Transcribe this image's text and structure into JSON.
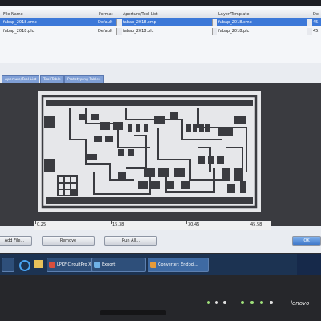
{
  "file_table": {
    "headers": [
      "File Name",
      "Format",
      "Aperture/Tool List",
      "Layer/Template",
      "De"
    ],
    "rows": [
      {
        "name": "fabap_2018.cmp",
        "format": "Default",
        "aperture": "fabap_2018.cmp",
        "layer": "fabap_2018.cmp",
        "extra": "45.",
        "selected": true
      },
      {
        "name": "fabap_2018.plc",
        "format": "Default",
        "aperture": "fabap_2018.plc",
        "layer": "fabap_2018.plc",
        "extra": "45.",
        "selected": false
      }
    ]
  },
  "tabs": [
    "Aperture/Tool List",
    "Tool Table",
    "Prototyping Tables"
  ],
  "ruler": {
    "labels": [
      "0.25",
      "15.38",
      "30.46",
      "45.58"
    ]
  },
  "buttons": {
    "add": "Add File...",
    "remove": "Remove",
    "run": "Run All...",
    "ok": "OK"
  },
  "taskbar": {
    "items": [
      {
        "label": "LPKF CircuitPro X..."
      },
      {
        "label": "Export"
      },
      {
        "label": "Converter: Endpoi..."
      }
    ]
  },
  "brand": "lenovo"
}
